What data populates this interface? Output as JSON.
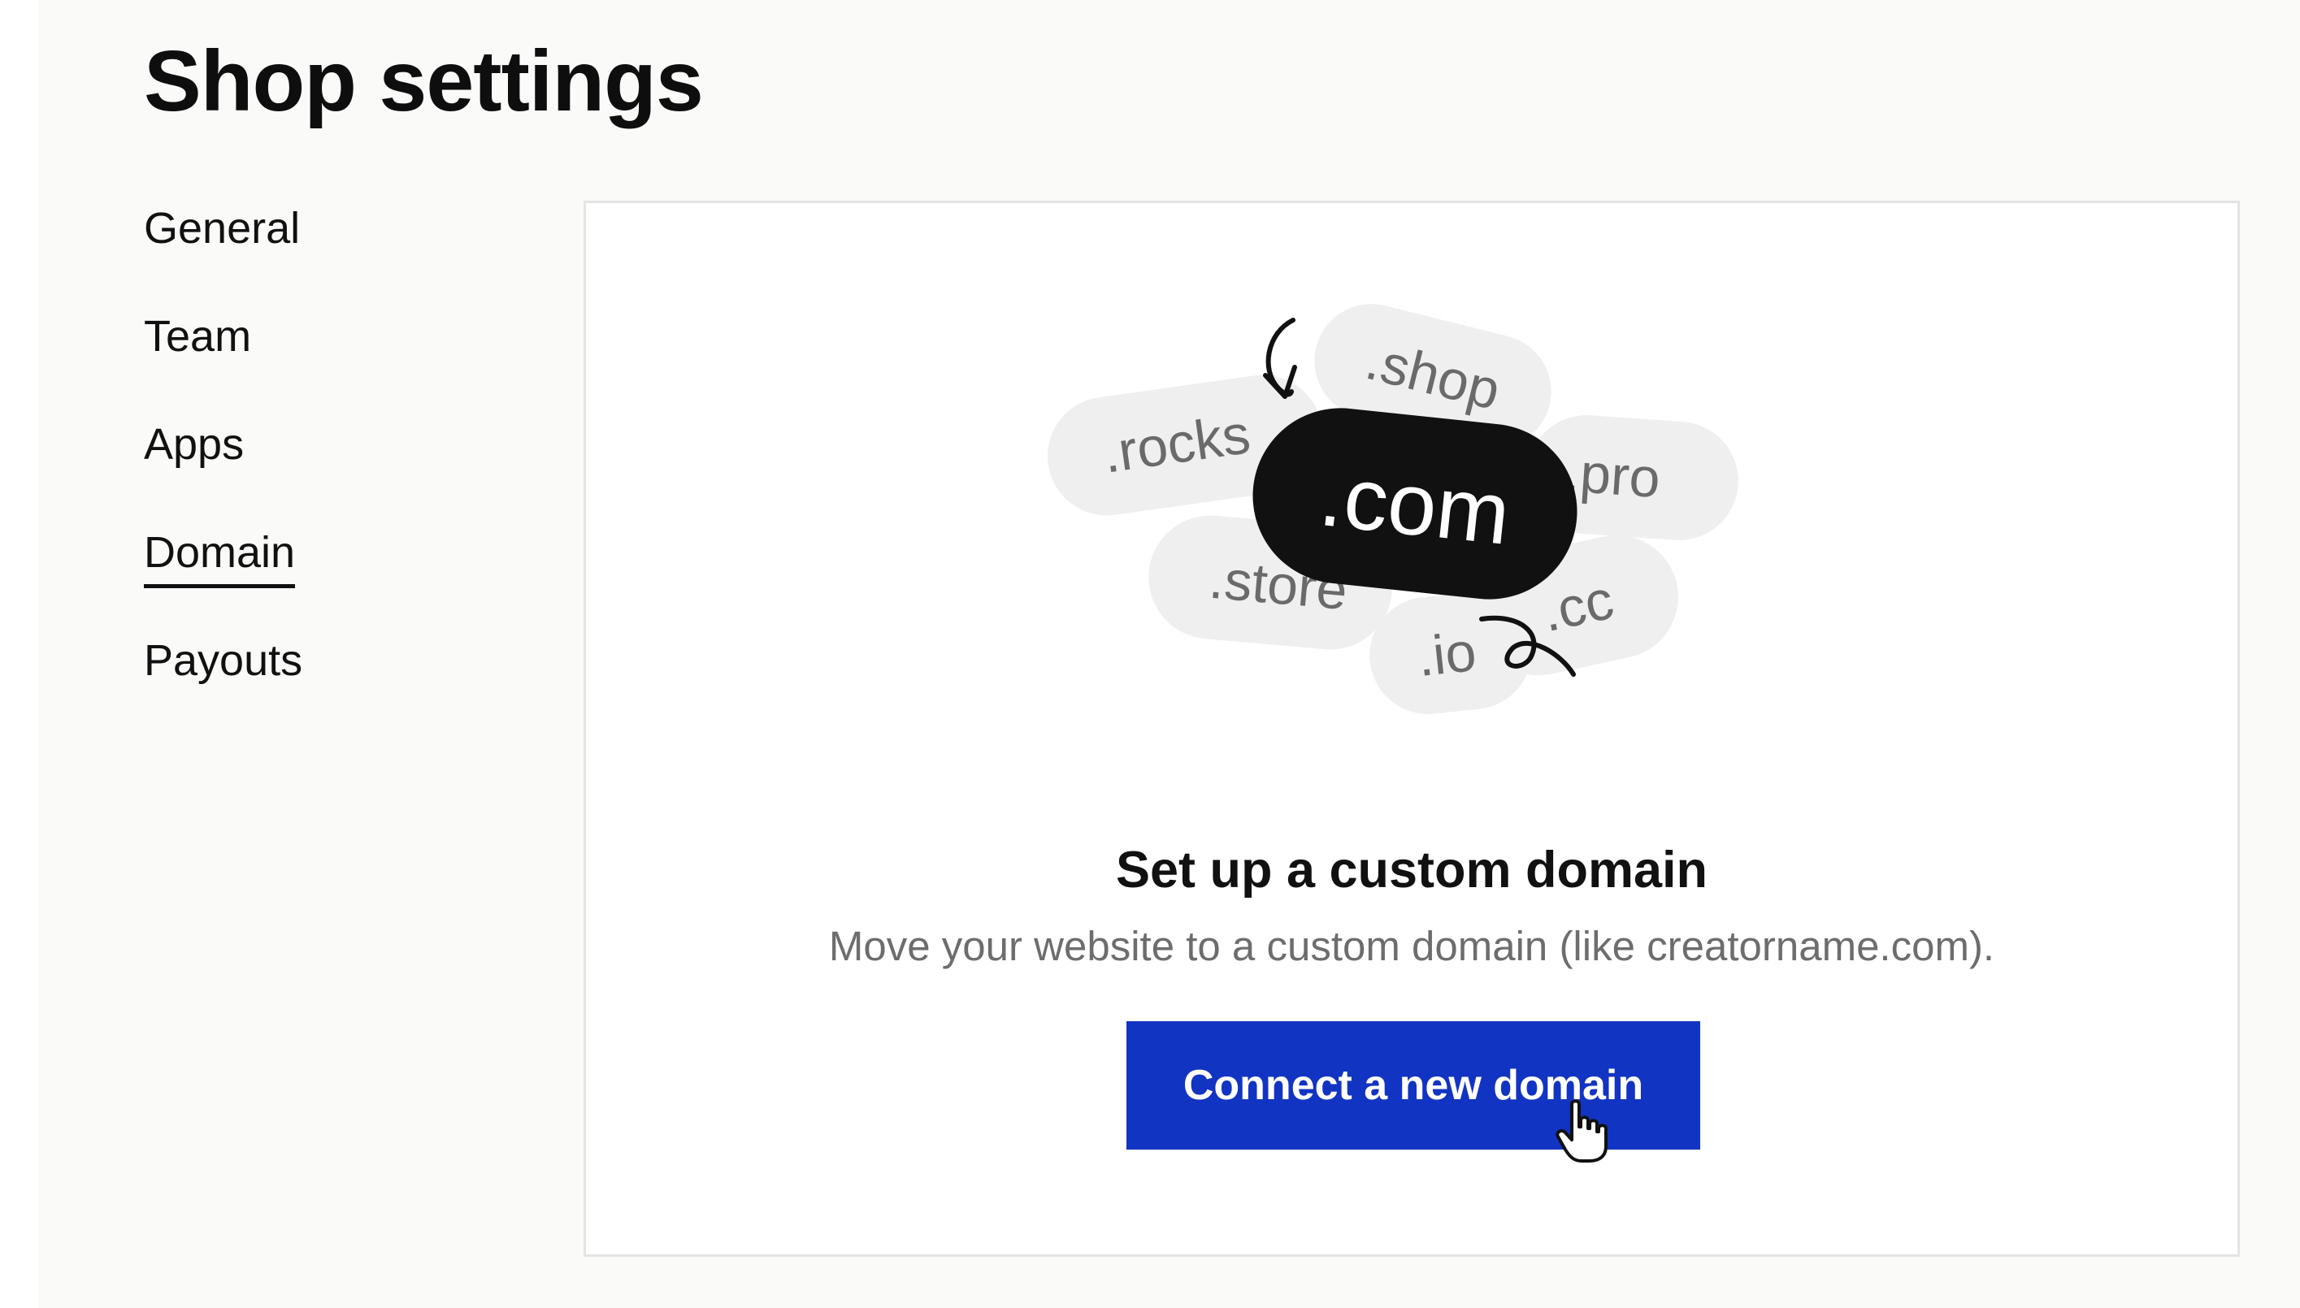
{
  "header": {
    "title": "Shop settings"
  },
  "sidebar": {
    "items": [
      {
        "label": "General",
        "active": false
      },
      {
        "label": "Team",
        "active": false
      },
      {
        "label": "Apps",
        "active": false
      },
      {
        "label": "Domain",
        "active": true
      },
      {
        "label": "Payouts",
        "active": false
      }
    ]
  },
  "domain_card": {
    "illustration": {
      "main": ".com",
      "tags": [
        ".shop",
        ".rocks",
        ".pro",
        ".store",
        ".cc",
        ".io"
      ]
    },
    "heading": "Set up a custom domain",
    "description": "Move your website to a custom domain (like creatorname.com).",
    "button_label": "Connect a new domain"
  },
  "colors": {
    "accent": "#1234c2",
    "pill": "#efefef",
    "pill_dark": "#111111",
    "text_muted": "#6d6d6d"
  }
}
